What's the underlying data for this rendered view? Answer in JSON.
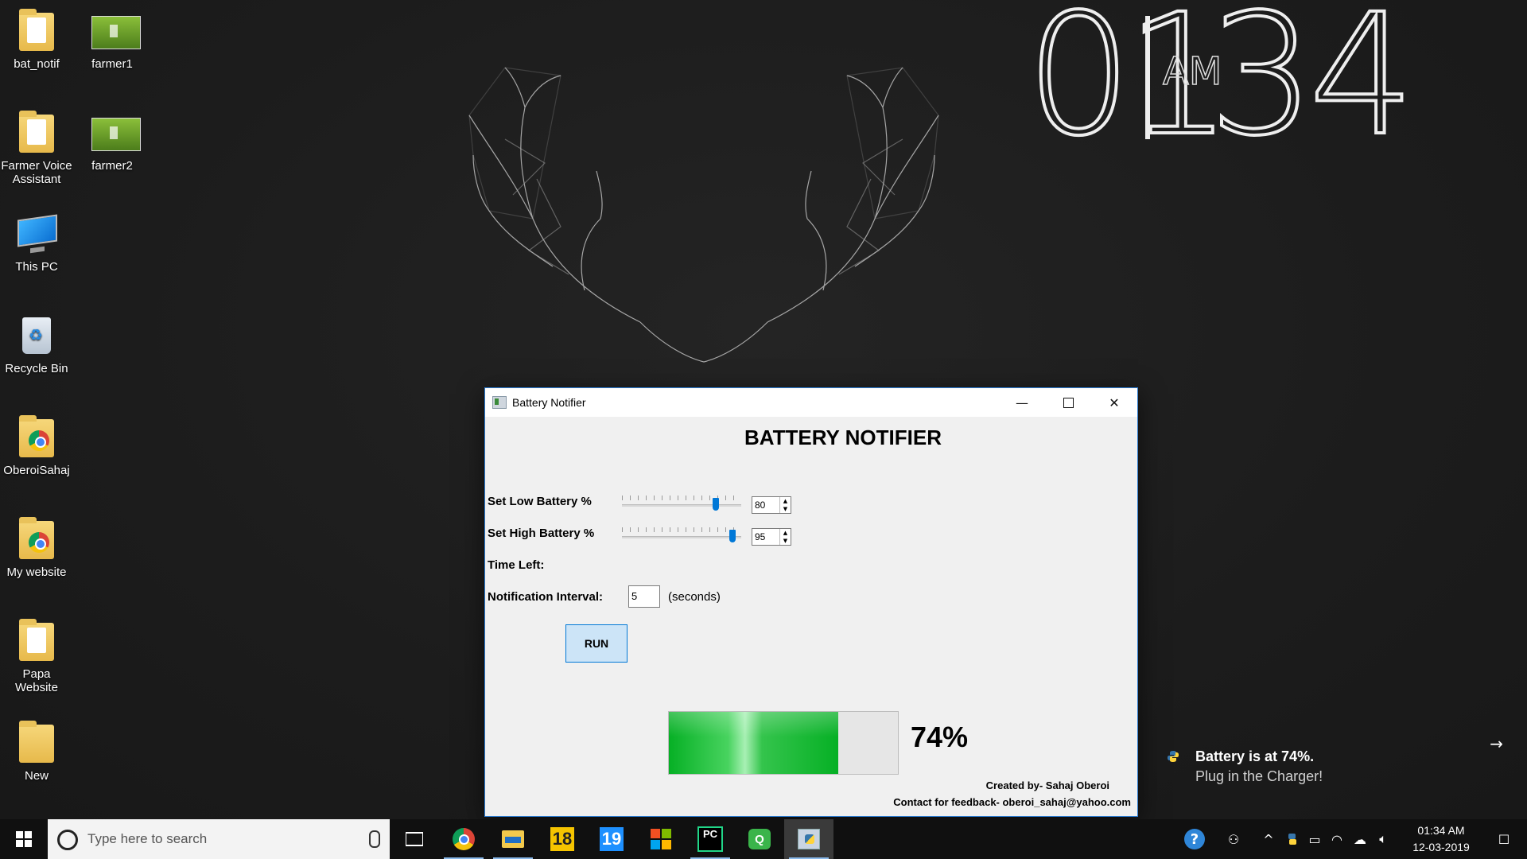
{
  "desktop": {
    "icons": [
      {
        "label": "bat_notif"
      },
      {
        "label": "farmer1"
      },
      {
        "label": "Farmer Voice Assistant"
      },
      {
        "label": "farmer2"
      },
      {
        "label": "This PC"
      },
      {
        "label": "Recycle Bin"
      },
      {
        "label": "OberoiSahaj"
      },
      {
        "label": "My website"
      },
      {
        "label": "Papa Website"
      },
      {
        "label": "New"
      }
    ],
    "clock": {
      "hours": "01",
      "minutes": "34",
      "ampm": "AM"
    }
  },
  "window": {
    "title": "Battery Notifier",
    "controls": {
      "minimize": "—",
      "close": "✕"
    },
    "heading": "BATTERY NOTIFIER",
    "low_battery": {
      "label": "Set Low Battery %",
      "value": "80",
      "slider_fraction": 0.8
    },
    "high_battery": {
      "label": "Set High Battery %",
      "value": "95",
      "slider_fraction": 0.95
    },
    "time_left": {
      "label": "Time Left:"
    },
    "interval": {
      "label": "Notification Interval:",
      "value": "5",
      "unit": "(seconds)"
    },
    "run_label": "RUN",
    "battery": {
      "level": 74,
      "text": "74%"
    },
    "credit": "Created by- Sahaj Oberoi",
    "contact": "Contact for feedback- oberoi_sahaj@yahoo.com"
  },
  "toast": {
    "title": "Battery is at 74%.",
    "message": "Plug in the Charger!",
    "arrow": "→"
  },
  "taskbar": {
    "search_placeholder": "Type here to search",
    "apps": [
      "search-cortana",
      "task-view",
      "chrome",
      "file-explorer",
      "app-18",
      "app-19",
      "microsoft-store",
      "pycharm",
      "green-app",
      "python-app"
    ],
    "app18_label": "18",
    "app19_label": "19",
    "pycharm_label": "PC",
    "green_label": "Q",
    "tray": {
      "help": "?",
      "people": "⚇",
      "chevron": "^",
      "battery": "▭",
      "wifi": "◠",
      "cloud": "☁",
      "volume": "🔈︎",
      "notifications": "☐"
    },
    "time": "01:34 AM",
    "date": "12-03-2019"
  },
  "colors": {
    "window_border": "#2b7cd3",
    "progress_fill": "#06b025",
    "slider_thumb": "#0078d7",
    "run_button_bg": "#cce4f7"
  }
}
